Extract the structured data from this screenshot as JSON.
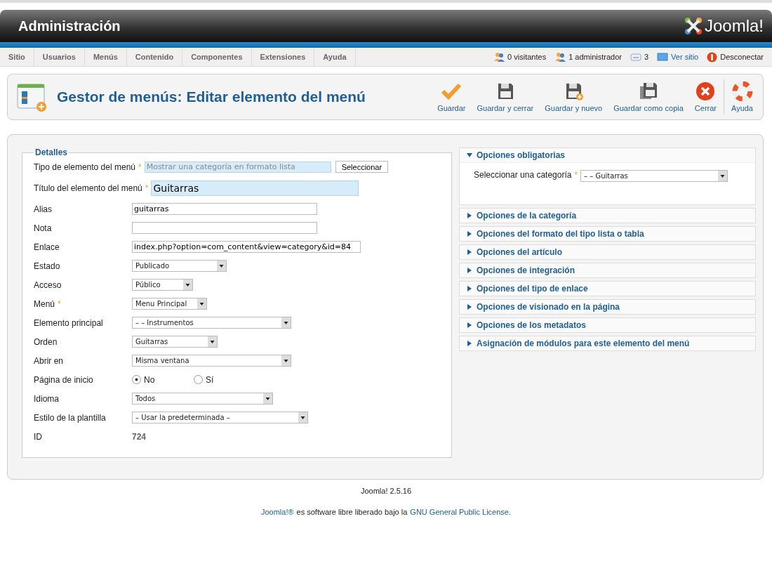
{
  "header": {
    "title": "Administración",
    "logo_text": "Joomla!"
  },
  "nav": {
    "items": [
      "Sitio",
      "Usuarios",
      "Menús",
      "Contenido",
      "Componentes",
      "Extensiones",
      "Ayuda"
    ],
    "status": [
      {
        "kind": "visitors",
        "text": "0 visitantes",
        "link": false
      },
      {
        "kind": "admins",
        "text": "1 administrador",
        "link": false
      },
      {
        "kind": "messages",
        "text": "3",
        "link": false
      },
      {
        "kind": "site",
        "text": "Ver sitio",
        "link": true
      },
      {
        "kind": "logout",
        "text": "Desconectar",
        "link": false
      }
    ]
  },
  "page_title": "Gestor de menús: Editar elemento del menú",
  "toolbar": [
    {
      "kind": "check",
      "label": "Guardar"
    },
    {
      "kind": "save",
      "label": "Guardar y cerrar"
    },
    {
      "kind": "save-new",
      "label": "Guardar y nuevo"
    },
    {
      "kind": "save-copy",
      "label": "Guardar como copia"
    },
    {
      "kind": "close",
      "label": "Cerrar"
    },
    {
      "kind": "help",
      "label": "Ayuda"
    }
  ],
  "details": {
    "legend": "Detalles",
    "fields": [
      {
        "kind": "type",
        "label": "Tipo de elemento del menú",
        "required_mark": "*",
        "placeholder": "Mostrar una categoría en formato lista",
        "button": "Seleccionar"
      },
      {
        "kind": "title",
        "label": "Título del elemento del menú",
        "required_mark": "*",
        "value": "Guitarras"
      },
      {
        "kind": "text",
        "label": "Alias",
        "value": "guitarras"
      },
      {
        "kind": "text",
        "label": "Nota"
      },
      {
        "kind": "link",
        "label": "Enlace",
        "value": "index.php?option=com_content&view=category&id=84"
      },
      {
        "kind": "select",
        "label": "Estado",
        "value": "Publicado"
      },
      {
        "kind": "select",
        "label": "Acceso",
        "value": "Público"
      },
      {
        "kind": "select",
        "label": "Menú",
        "required_mark": "*",
        "value": "Menu Principal"
      },
      {
        "kind": "select",
        "label": "Elemento principal",
        "value": "– – Instrumentos"
      },
      {
        "kind": "select",
        "label": "Orden",
        "value": "Guitarras"
      },
      {
        "kind": "select",
        "label": "Abrir en",
        "value": "Misma ventana"
      },
      {
        "kind": "radio",
        "label": "Página de inicio",
        "options": [
          {
            "label": "No",
            "selected": true
          },
          {
            "label": "Sí",
            "selected": false
          }
        ]
      },
      {
        "kind": "select",
        "label": "Idioma",
        "value": "Todos"
      },
      {
        "kind": "select",
        "label": "Estilo de la plantilla",
        "value": "– Usar la predeterminada –"
      },
      {
        "kind": "static",
        "label": "ID",
        "value": "724"
      }
    ]
  },
  "panels": [
    {
      "title": "Opciones obligatorias",
      "expanded": true,
      "field": {
        "label": "Seleccionar una categoría",
        "required_mark": "*",
        "value": "– – Guitarras"
      }
    },
    {
      "title": "Opciones de la categoría",
      "expanded": false
    },
    {
      "title": "Opciones del formato del tipo lista o tabla",
      "expanded": false
    },
    {
      "title": "Opciones del artículo",
      "expanded": false
    },
    {
      "title": "Opciones de integración",
      "expanded": false
    },
    {
      "title": "Opciones del tipo de enlace",
      "expanded": false
    },
    {
      "title": "Opciones de visionado en la página",
      "expanded": false
    },
    {
      "title": "Opciones de los metadatos",
      "expanded": false
    },
    {
      "title": "Asignación de módulos para este elemento del menú",
      "expanded": false
    }
  ],
  "footer": {
    "version": "Joomla! 2.5.16",
    "license_link": "Joomla!®",
    "license_text": "es software libre liberado bajo la",
    "license_name": "GNU General Public License."
  }
}
